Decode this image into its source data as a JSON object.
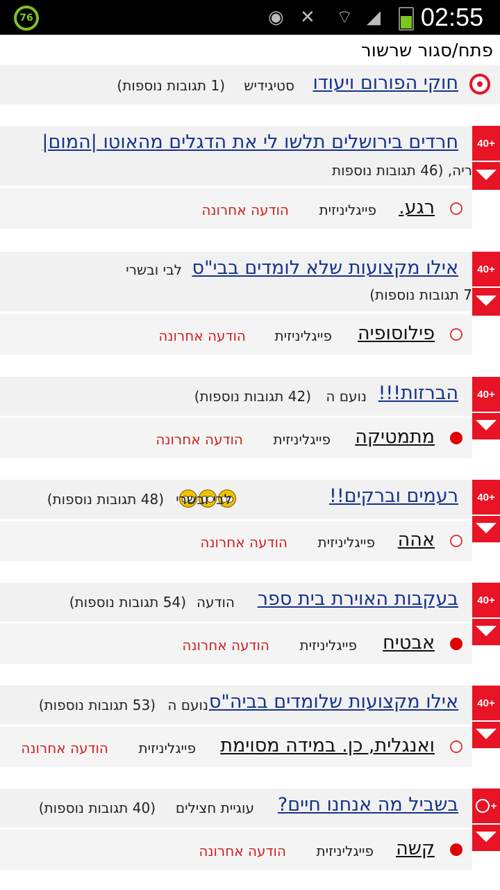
{
  "status_bar": {
    "battery_circle": "76",
    "time": "02:55",
    "icons": [
      "eye-icon",
      "mute-icon",
      "wifi-icon",
      "signal-icon",
      "battery-icon"
    ]
  },
  "toggle_label": "פתח/סגור שרשור",
  "pinned": {
    "title": "חוקי הפורום ויעודו",
    "author": "סטיגידיש",
    "replies": "(1 תגובות נוספות)"
  },
  "threads": [
    {
      "title": "חרדים בירושלים תלשו לי את הדגלים מהאוטו |המום|",
      "meta_line": "ריה,   (46 תגובות נוספות",
      "badge": "40+",
      "last_title": "רגע.",
      "last_author": "פייגליניזית",
      "last_label": "הודעה אחרונה"
    },
    {
      "title": "אילו מקצועות שלא לומדים בבי\"ס",
      "author": "לבי ובשרי",
      "meta_line": "7 תגובות נוספות)",
      "badge": "40+",
      "last_title": "פילוסופיה",
      "last_author": "פייגליניזית",
      "last_label": "הודעה אחרונה"
    },
    {
      "title": "הברזות!!!",
      "author": "נועם ה",
      "replies": "(42 תגובות נוספות)",
      "badge": "40+",
      "last_title": "מתמטיקה",
      "last_author": "פייגליניזית",
      "last_label": "הודעה אחרונה"
    },
    {
      "title": "רעמים וברקים!!",
      "author": "לבי ובשרי",
      "replies": "(48 תגובות נוספות)",
      "badge": "40+",
      "last_title": "אהה",
      "last_author": "פייגליניזית",
      "last_label": "הודעה אחרונה"
    },
    {
      "title": "בעקבות האוירת בית ספר",
      "author": "הודעה",
      "replies": "(54 תגובות נוספות)",
      "badge": "40+",
      "last_title": "אבטיח",
      "last_author": "פייגליניזית",
      "last_label": "הודעה אחרונה"
    },
    {
      "title": "אילו מקצועות שלומדים בביה\"ס",
      "author": "נועם ה",
      "replies": "(53 תגובות נוספות)",
      "badge": "40+",
      "last_title": "ואנגלית, כן. במידה מסוימת",
      "last_author": "פייגליניזית",
      "last_label": "הודעה אחרונה"
    },
    {
      "title": "בשביל מה אנחנו חיים?",
      "author": "עוגיית חצילים",
      "replies": "(40 תגובות נוספות)",
      "badge": "+",
      "last_title": "קשה",
      "last_author": "פייגליניזית",
      "last_label": "הודעה אחרונה"
    }
  ]
}
